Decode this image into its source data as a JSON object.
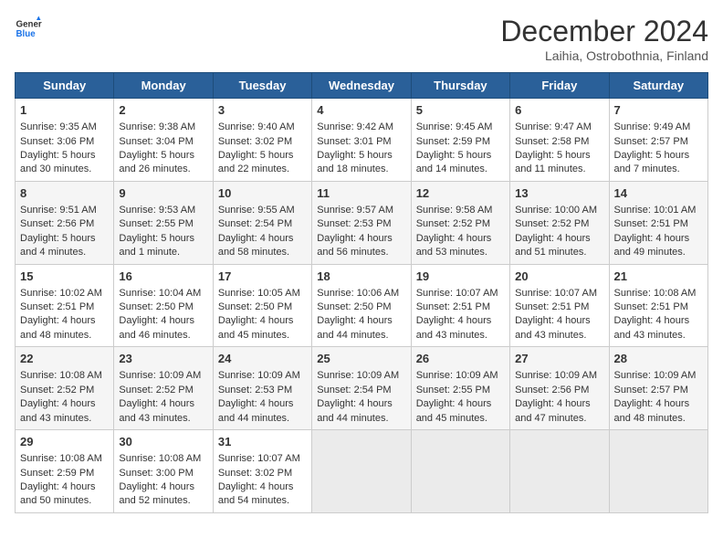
{
  "logo": {
    "line1": "General",
    "line2": "Blue"
  },
  "title": "December 2024",
  "subtitle": "Laihia, Ostrobothnia, Finland",
  "days_of_week": [
    "Sunday",
    "Monday",
    "Tuesday",
    "Wednesday",
    "Thursday",
    "Friday",
    "Saturday"
  ],
  "weeks": [
    [
      {
        "day": "1",
        "info": "Sunrise: 9:35 AM\nSunset: 3:06 PM\nDaylight: 5 hours\nand 30 minutes."
      },
      {
        "day": "2",
        "info": "Sunrise: 9:38 AM\nSunset: 3:04 PM\nDaylight: 5 hours\nand 26 minutes."
      },
      {
        "day": "3",
        "info": "Sunrise: 9:40 AM\nSunset: 3:02 PM\nDaylight: 5 hours\nand 22 minutes."
      },
      {
        "day": "4",
        "info": "Sunrise: 9:42 AM\nSunset: 3:01 PM\nDaylight: 5 hours\nand 18 minutes."
      },
      {
        "day": "5",
        "info": "Sunrise: 9:45 AM\nSunset: 2:59 PM\nDaylight: 5 hours\nand 14 minutes."
      },
      {
        "day": "6",
        "info": "Sunrise: 9:47 AM\nSunset: 2:58 PM\nDaylight: 5 hours\nand 11 minutes."
      },
      {
        "day": "7",
        "info": "Sunrise: 9:49 AM\nSunset: 2:57 PM\nDaylight: 5 hours\nand 7 minutes."
      }
    ],
    [
      {
        "day": "8",
        "info": "Sunrise: 9:51 AM\nSunset: 2:56 PM\nDaylight: 5 hours\nand 4 minutes."
      },
      {
        "day": "9",
        "info": "Sunrise: 9:53 AM\nSunset: 2:55 PM\nDaylight: 5 hours\nand 1 minute."
      },
      {
        "day": "10",
        "info": "Sunrise: 9:55 AM\nSunset: 2:54 PM\nDaylight: 4 hours\nand 58 minutes."
      },
      {
        "day": "11",
        "info": "Sunrise: 9:57 AM\nSunset: 2:53 PM\nDaylight: 4 hours\nand 56 minutes."
      },
      {
        "day": "12",
        "info": "Sunrise: 9:58 AM\nSunset: 2:52 PM\nDaylight: 4 hours\nand 53 minutes."
      },
      {
        "day": "13",
        "info": "Sunrise: 10:00 AM\nSunset: 2:52 PM\nDaylight: 4 hours\nand 51 minutes."
      },
      {
        "day": "14",
        "info": "Sunrise: 10:01 AM\nSunset: 2:51 PM\nDaylight: 4 hours\nand 49 minutes."
      }
    ],
    [
      {
        "day": "15",
        "info": "Sunrise: 10:02 AM\nSunset: 2:51 PM\nDaylight: 4 hours\nand 48 minutes."
      },
      {
        "day": "16",
        "info": "Sunrise: 10:04 AM\nSunset: 2:50 PM\nDaylight: 4 hours\nand 46 minutes."
      },
      {
        "day": "17",
        "info": "Sunrise: 10:05 AM\nSunset: 2:50 PM\nDaylight: 4 hours\nand 45 minutes."
      },
      {
        "day": "18",
        "info": "Sunrise: 10:06 AM\nSunset: 2:50 PM\nDaylight: 4 hours\nand 44 minutes."
      },
      {
        "day": "19",
        "info": "Sunrise: 10:07 AM\nSunset: 2:51 PM\nDaylight: 4 hours\nand 43 minutes."
      },
      {
        "day": "20",
        "info": "Sunrise: 10:07 AM\nSunset: 2:51 PM\nDaylight: 4 hours\nand 43 minutes."
      },
      {
        "day": "21",
        "info": "Sunrise: 10:08 AM\nSunset: 2:51 PM\nDaylight: 4 hours\nand 43 minutes."
      }
    ],
    [
      {
        "day": "22",
        "info": "Sunrise: 10:08 AM\nSunset: 2:52 PM\nDaylight: 4 hours\nand 43 minutes."
      },
      {
        "day": "23",
        "info": "Sunrise: 10:09 AM\nSunset: 2:52 PM\nDaylight: 4 hours\nand 43 minutes."
      },
      {
        "day": "24",
        "info": "Sunrise: 10:09 AM\nSunset: 2:53 PM\nDaylight: 4 hours\nand 44 minutes."
      },
      {
        "day": "25",
        "info": "Sunrise: 10:09 AM\nSunset: 2:54 PM\nDaylight: 4 hours\nand 44 minutes."
      },
      {
        "day": "26",
        "info": "Sunrise: 10:09 AM\nSunset: 2:55 PM\nDaylight: 4 hours\nand 45 minutes."
      },
      {
        "day": "27",
        "info": "Sunrise: 10:09 AM\nSunset: 2:56 PM\nDaylight: 4 hours\nand 47 minutes."
      },
      {
        "day": "28",
        "info": "Sunrise: 10:09 AM\nSunset: 2:57 PM\nDaylight: 4 hours\nand 48 minutes."
      }
    ],
    [
      {
        "day": "29",
        "info": "Sunrise: 10:08 AM\nSunset: 2:59 PM\nDaylight: 4 hours\nand 50 minutes."
      },
      {
        "day": "30",
        "info": "Sunrise: 10:08 AM\nSunset: 3:00 PM\nDaylight: 4 hours\nand 52 minutes."
      },
      {
        "day": "31",
        "info": "Sunrise: 10:07 AM\nSunset: 3:02 PM\nDaylight: 4 hours\nand 54 minutes."
      },
      {
        "day": "",
        "info": ""
      },
      {
        "day": "",
        "info": ""
      },
      {
        "day": "",
        "info": ""
      },
      {
        "day": "",
        "info": ""
      }
    ]
  ]
}
